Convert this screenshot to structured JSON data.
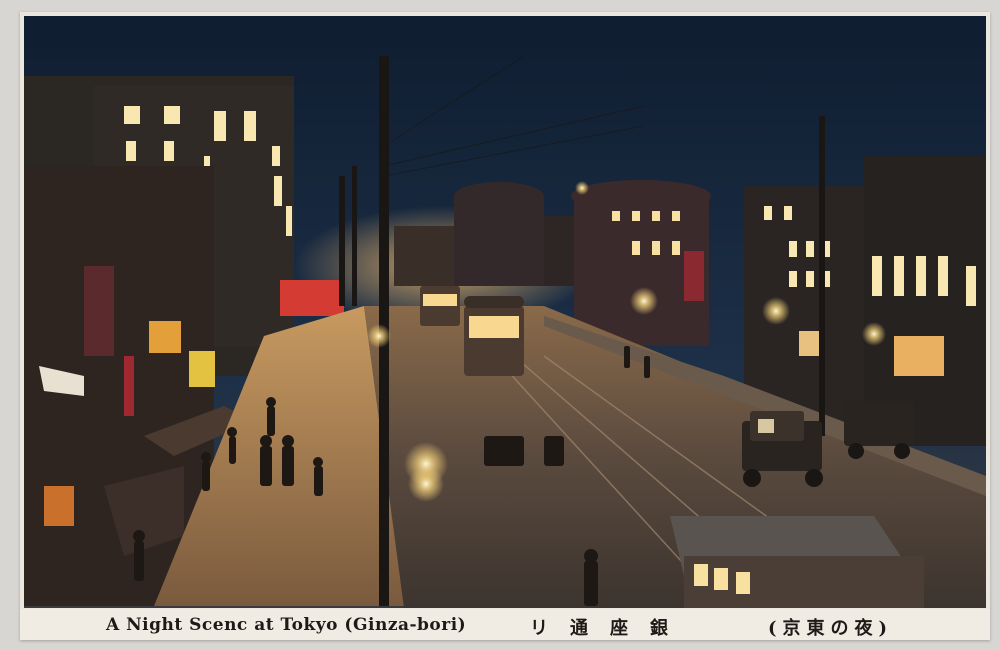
{
  "postcard": {
    "caption_english": "A Night Scenc at Tokyo (Ginza-bori)",
    "caption_japanese_street": "リ通座銀",
    "caption_japanese_title": "(京東の夜)"
  },
  "colors": {
    "sky": "#14233a",
    "building": "#2a2622",
    "glow": "#f5d27a",
    "street": "#5a4a3e",
    "paper": "#f1ece3",
    "red_sign": "#d43b33"
  }
}
